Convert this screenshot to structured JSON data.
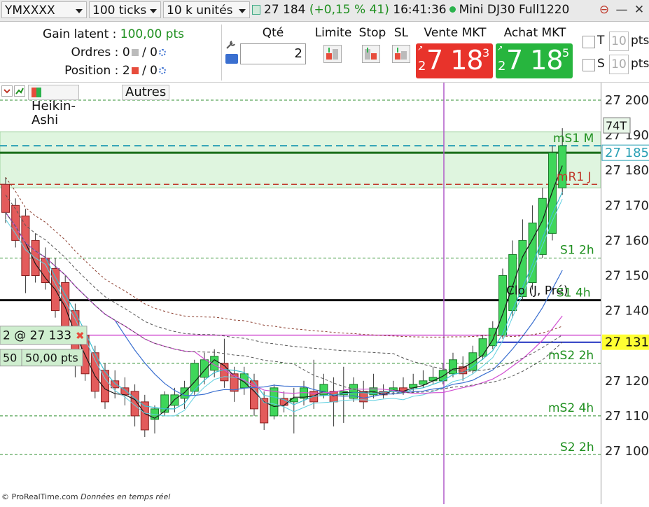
{
  "toolbar": {
    "symbol": "YMXXXX",
    "ticks": "100 ticks",
    "units": "10 k unités",
    "last_price": "27 184",
    "change": "(+0,15 % 41)",
    "time": "16:41:36",
    "contract": "Mini DJ30 Full1220"
  },
  "panel": {
    "gain_label": "Gain latent :",
    "gain_value": "100,00 pts",
    "orders_label": "Ordres :",
    "orders_a": "0",
    "orders_b": "/ 0",
    "position_label": "Position :",
    "position_a": "2",
    "position_b": "/ 0",
    "qty_label": "Qté",
    "qty_value": "2",
    "limit_label": "Limite",
    "stop_label": "Stop",
    "sl_label": "SL",
    "sell_label": "Vente MKT",
    "buy_label": "Achat MKT",
    "sell_prefix": "2",
    "sell_main": "7 18",
    "sell_sup": "3",
    "buy_prefix": "2",
    "buy_main": "7 18",
    "buy_sup": "5",
    "t_label": "T",
    "s_label": "S",
    "t_value": "10",
    "s_value": "10",
    "pts": "pts"
  },
  "chart_header": {
    "heikin": "Heikin-Ashi",
    "autres": "Autres"
  },
  "chart_data": {
    "type": "candlestick",
    "y_range": [
      27095,
      27205
    ],
    "y_ticks": [
      "27 200",
      "27 190",
      "27 180",
      "27 170",
      "27 160",
      "27 150",
      "27 140",
      "27 131",
      "27 120",
      "27 110",
      "27 100"
    ],
    "y_tick_values": [
      27200,
      27190,
      27180,
      27170,
      27160,
      27150,
      27140,
      27131,
      27120,
      27110,
      27100
    ],
    "levels": [
      {
        "name": "mS1 M",
        "value": 27187
      },
      {
        "name": "mR1 J",
        "value": 27176
      },
      {
        "name": "S1 2h",
        "value": 27155
      },
      {
        "name": "Clo (J, Pré)",
        "value": 27143
      },
      {
        "name": "S1 4h",
        "value": 27143
      },
      {
        "name": "mS2 2h",
        "value": 27125
      },
      {
        "name": "mS2 4h",
        "value": 27110
      },
      {
        "name": "S2 2h",
        "value": 27099
      }
    ],
    "position_price": 27133,
    "position_tag": "2 @ 27 133",
    "pnl_tag_a": "50",
    "pnl_tag_b": "50,00 pts",
    "current_price_tag": "27 185",
    "volume_tag": "74T",
    "highlight_price_tag": "27 131",
    "candles": [
      {
        "o": 27176,
        "c": 27168,
        "h": 27178,
        "l": 27165
      },
      {
        "o": 27170,
        "c": 27160,
        "h": 27172,
        "l": 27158
      },
      {
        "o": 27167,
        "c": 27150,
        "h": 27169,
        "l": 27145
      },
      {
        "o": 27160,
        "c": 27150,
        "h": 27162,
        "l": 27148
      },
      {
        "o": 27155,
        "c": 27148,
        "h": 27158,
        "l": 27146
      },
      {
        "o": 27152,
        "c": 27140,
        "h": 27155,
        "l": 27138
      },
      {
        "o": 27148,
        "c": 27135,
        "h": 27150,
        "l": 27133
      },
      {
        "o": 27140,
        "c": 27125,
        "h": 27142,
        "l": 27121
      },
      {
        "o": 27133,
        "c": 27122,
        "h": 27135,
        "l": 27120
      },
      {
        "o": 27128,
        "c": 27117,
        "h": 27130,
        "l": 27115
      },
      {
        "o": 27123,
        "c": 27114,
        "h": 27125,
        "l": 27112
      },
      {
        "o": 27120,
        "c": 27118,
        "h": 27123,
        "l": 27115
      },
      {
        "o": 27118,
        "c": 27116,
        "h": 27121,
        "l": 27113
      },
      {
        "o": 27117,
        "c": 27110,
        "h": 27119,
        "l": 27107
      },
      {
        "o": 27114,
        "c": 27106,
        "h": 27116,
        "l": 27104
      },
      {
        "o": 27109,
        "c": 27112,
        "h": 27113,
        "l": 27105
      },
      {
        "o": 27111,
        "c": 27116,
        "h": 27117,
        "l": 27110
      },
      {
        "o": 27113,
        "c": 27116,
        "h": 27118,
        "l": 27111
      },
      {
        "o": 27115,
        "c": 27118,
        "h": 27120,
        "l": 27112
      },
      {
        "o": 27117,
        "c": 27125,
        "h": 27126,
        "l": 27116
      },
      {
        "o": 27121,
        "c": 27126,
        "h": 27128,
        "l": 27119
      },
      {
        "o": 27123,
        "c": 27127,
        "h": 27129,
        "l": 27121
      },
      {
        "o": 27125,
        "c": 27120,
        "h": 27132,
        "l": 27118
      },
      {
        "o": 27122,
        "c": 27117,
        "h": 27124,
        "l": 27114
      },
      {
        "o": 27118,
        "c": 27122,
        "h": 27124,
        "l": 27116
      },
      {
        "o": 27120,
        "c": 27112,
        "h": 27122,
        "l": 27110
      },
      {
        "o": 27115,
        "c": 27108,
        "h": 27117,
        "l": 27106
      },
      {
        "o": 27110,
        "c": 27118,
        "h": 27119,
        "l": 27109
      },
      {
        "o": 27115,
        "c": 27113,
        "h": 27117,
        "l": 27111
      },
      {
        "o": 27114,
        "c": 27115,
        "h": 27118,
        "l": 27105
      },
      {
        "o": 27115,
        "c": 27118,
        "h": 27120,
        "l": 27113
      },
      {
        "o": 27117,
        "c": 27114,
        "h": 27126,
        "l": 27112
      },
      {
        "o": 27116,
        "c": 27119,
        "h": 27122,
        "l": 27115
      },
      {
        "o": 27117,
        "c": 27114,
        "h": 27121,
        "l": 27107
      },
      {
        "o": 27116,
        "c": 27117,
        "h": 27124,
        "l": 27108
      },
      {
        "o": 27115,
        "c": 27119,
        "h": 27121,
        "l": 27114
      },
      {
        "o": 27117,
        "c": 27114,
        "h": 27120,
        "l": 27112
      },
      {
        "o": 27116,
        "c": 27118,
        "h": 27122,
        "l": 27115
      },
      {
        "o": 27117,
        "c": 27116,
        "h": 27119,
        "l": 27115
      },
      {
        "o": 27117,
        "c": 27118,
        "h": 27120,
        "l": 27116
      },
      {
        "o": 27118,
        "c": 27117,
        "h": 27121,
        "l": 27116
      },
      {
        "o": 27118,
        "c": 27119,
        "h": 27122,
        "l": 27117
      },
      {
        "o": 27119,
        "c": 27120,
        "h": 27123,
        "l": 27118
      },
      {
        "o": 27120,
        "c": 27121,
        "h": 27124,
        "l": 27119
      },
      {
        "o": 27120,
        "c": 27123,
        "h": 27125,
        "l": 27119
      },
      {
        "o": 27122,
        "c": 27126,
        "h": 27128,
        "l": 27121
      },
      {
        "o": 27124,
        "c": 27122,
        "h": 27127,
        "l": 27120
      },
      {
        "o": 27123,
        "c": 27128,
        "h": 27130,
        "l": 27122
      },
      {
        "o": 27127,
        "c": 27132,
        "h": 27133,
        "l": 27126
      },
      {
        "o": 27130,
        "c": 27135,
        "h": 27137,
        "l": 27129
      },
      {
        "o": 27133,
        "c": 27150,
        "h": 27152,
        "l": 27132
      },
      {
        "o": 27140,
        "c": 27156,
        "h": 27160,
        "l": 27138
      },
      {
        "o": 27144,
        "c": 27160,
        "h": 27166,
        "l": 27143
      },
      {
        "o": 27148,
        "c": 27165,
        "h": 27170,
        "l": 27146
      },
      {
        "o": 27156,
        "c": 27172,
        "h": 27175,
        "l": 27155
      },
      {
        "o": 27162,
        "c": 27185,
        "h": 27187,
        "l": 27160
      },
      {
        "o": 27175,
        "c": 27187,
        "h": 27192,
        "l": 27173
      }
    ]
  }
}
